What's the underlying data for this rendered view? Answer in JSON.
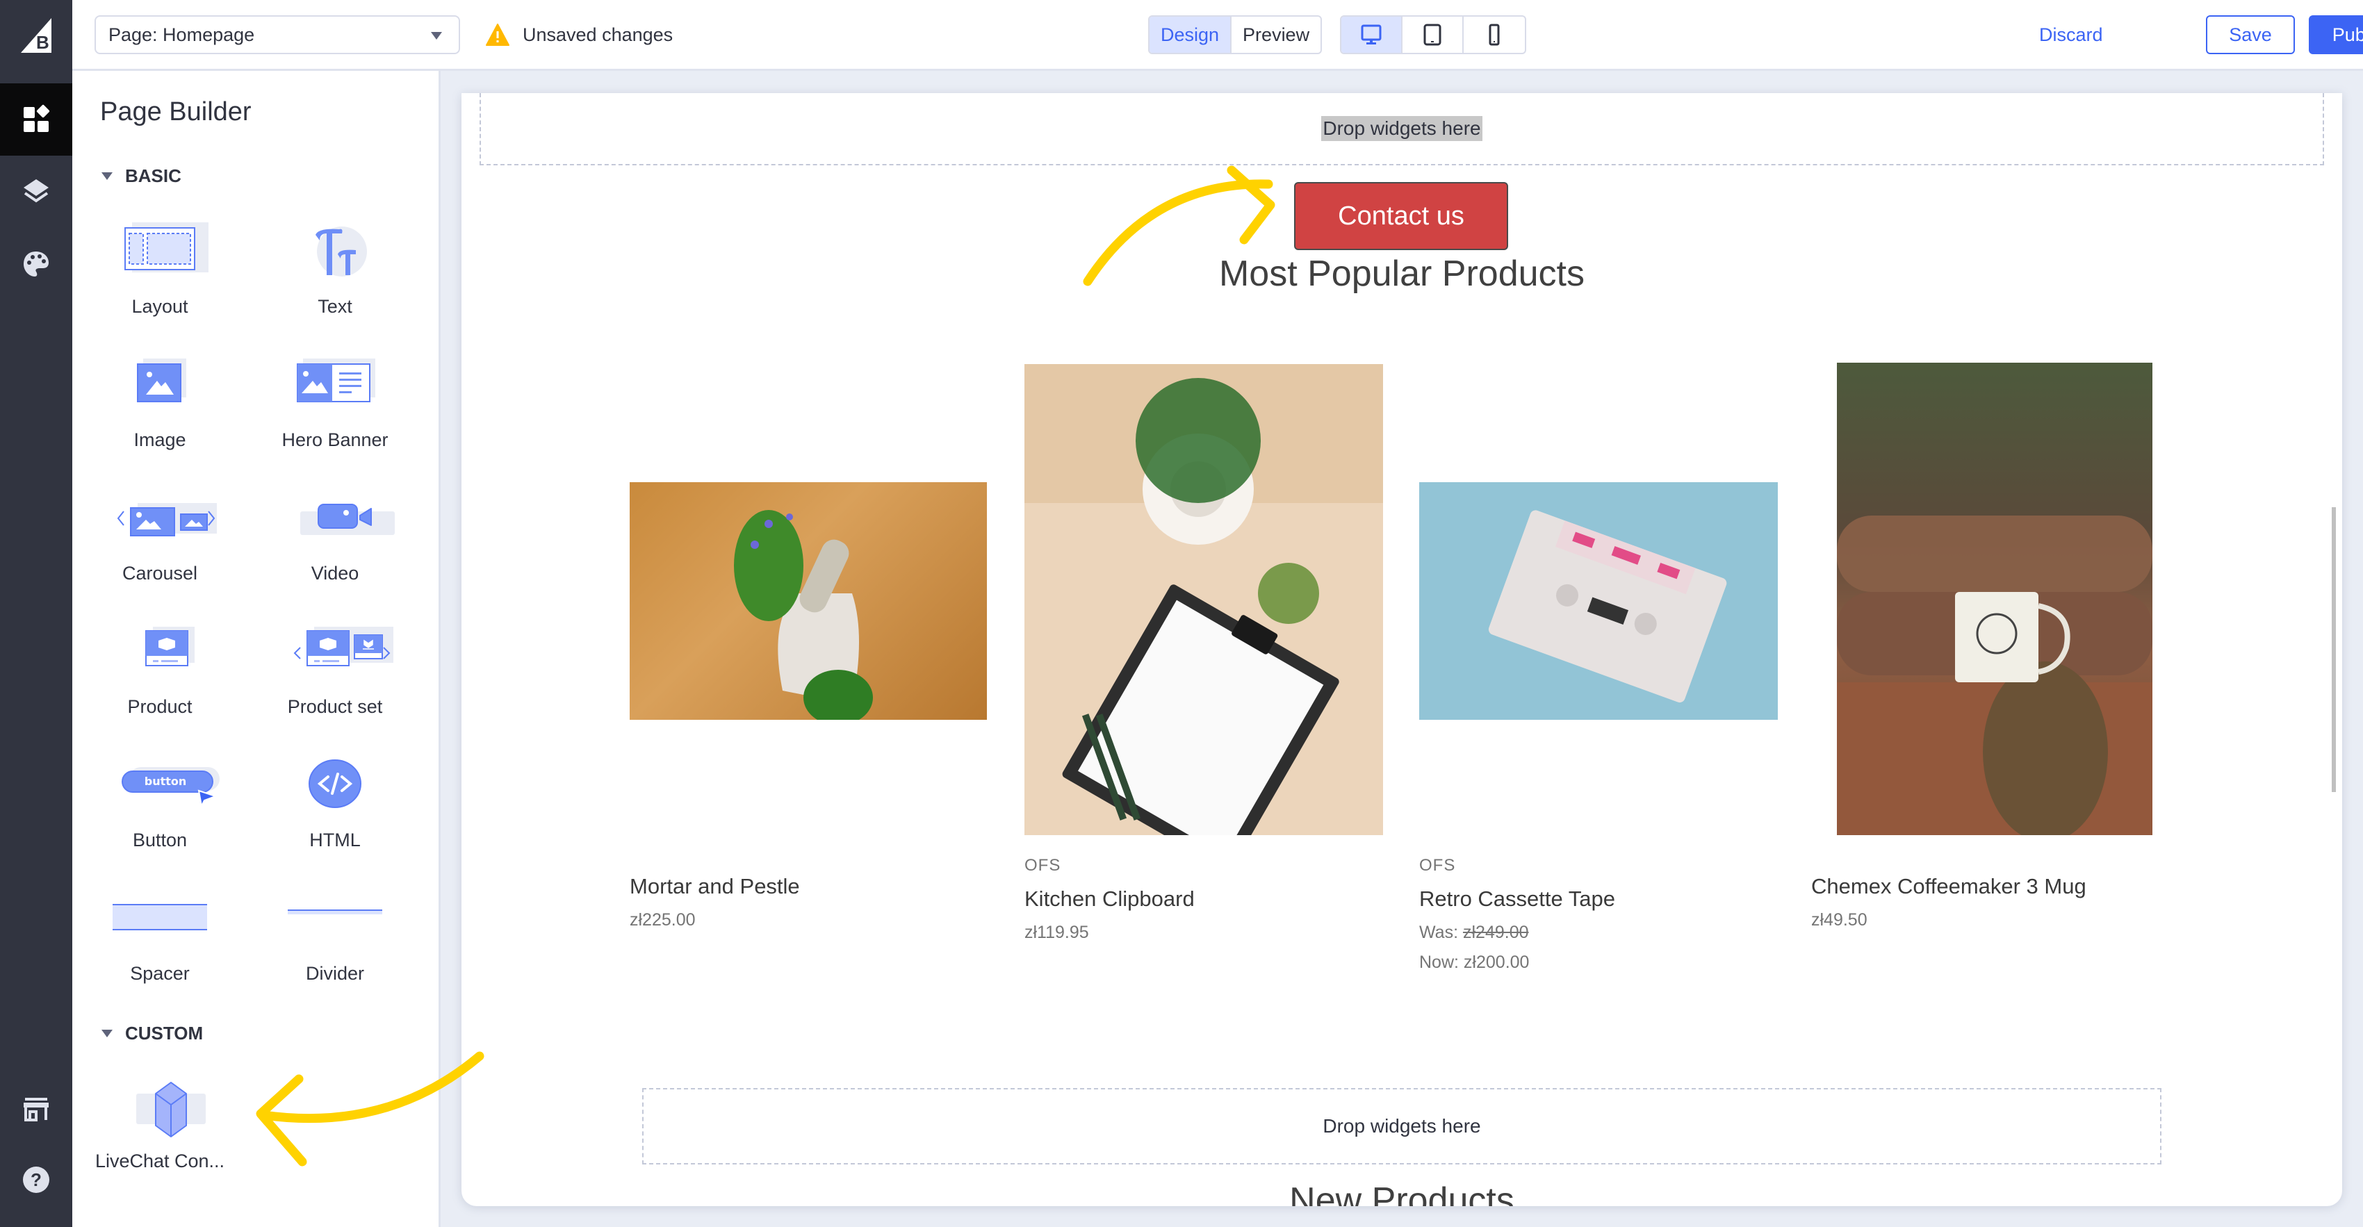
{
  "app": {
    "logo": "bigcommerce-logo"
  },
  "rail": {
    "items": [
      {
        "name": "widgets",
        "icon": "widgets-icon",
        "active": true
      },
      {
        "name": "layers",
        "icon": "layers-icon",
        "active": false
      },
      {
        "name": "theme-styles",
        "icon": "palette-icon",
        "active": false
      },
      {
        "name": "storefront",
        "icon": "store-icon",
        "active": false
      },
      {
        "name": "help",
        "icon": "help-icon",
        "active": false
      }
    ]
  },
  "topbar": {
    "page_select": "Page: Homepage",
    "unsaved": "Unsaved changes",
    "mode": {
      "design": "Design",
      "preview": "Preview",
      "active": "Design"
    },
    "devices": [
      {
        "name": "desktop",
        "icon": "desktop-icon",
        "active": true
      },
      {
        "name": "tablet",
        "icon": "tablet-icon",
        "active": false
      },
      {
        "name": "mobile",
        "icon": "mobile-icon",
        "active": false
      }
    ],
    "discard": "Discard",
    "save": "Save",
    "publish": "Publish"
  },
  "sidebar": {
    "title": "Page Builder",
    "sections": {
      "basic": "BASIC",
      "custom": "CUSTOM"
    },
    "basic_widgets": [
      {
        "label": "Layout",
        "icon": "layout-icon"
      },
      {
        "label": "Text",
        "icon": "text-icon"
      },
      {
        "label": "Image",
        "icon": "image-icon"
      },
      {
        "label": "Hero Banner",
        "icon": "hero-banner-icon"
      },
      {
        "label": "Carousel",
        "icon": "carousel-icon"
      },
      {
        "label": "Video",
        "icon": "video-icon"
      },
      {
        "label": "Product",
        "icon": "product-icon"
      },
      {
        "label": "Product set",
        "icon": "product-set-icon"
      },
      {
        "label": "Button",
        "icon": "button-icon",
        "icon_text": "button"
      },
      {
        "label": "HTML",
        "icon": "html-icon"
      },
      {
        "label": "Spacer",
        "icon": "spacer-icon"
      },
      {
        "label": "Divider",
        "icon": "divider-icon"
      }
    ],
    "custom_widgets": [
      {
        "label": "LiveChat Con...",
        "icon": "cube-icon"
      }
    ]
  },
  "canvas": {
    "drop_zone_top": "Drop widgets here",
    "contact_button": "Contact us",
    "popular_title": "Most Popular Products",
    "products": [
      {
        "brand": "",
        "name": "Mortar and Pestle",
        "price": "zł225.00"
      },
      {
        "brand": "OFS",
        "name": "Kitchen Clipboard",
        "price": "zł119.95"
      },
      {
        "brand": "OFS",
        "name": "Retro Cassette Tape",
        "was_label": "Was:",
        "was_price": "zł249.00",
        "now_label": "Now:",
        "now_price": "zł200.00"
      },
      {
        "brand": "",
        "name": "Chemex Coffeemaker 3 Mug",
        "price": "zł49.50"
      }
    ],
    "drop_zone_bottom": "Drop widgets here",
    "new_title": "New Products"
  },
  "colors": {
    "accent": "#3c64f4",
    "rail": "#313440",
    "contact_button": "#d04343",
    "annotation_arrow": "#ffd200",
    "warning": "#ffb800"
  }
}
